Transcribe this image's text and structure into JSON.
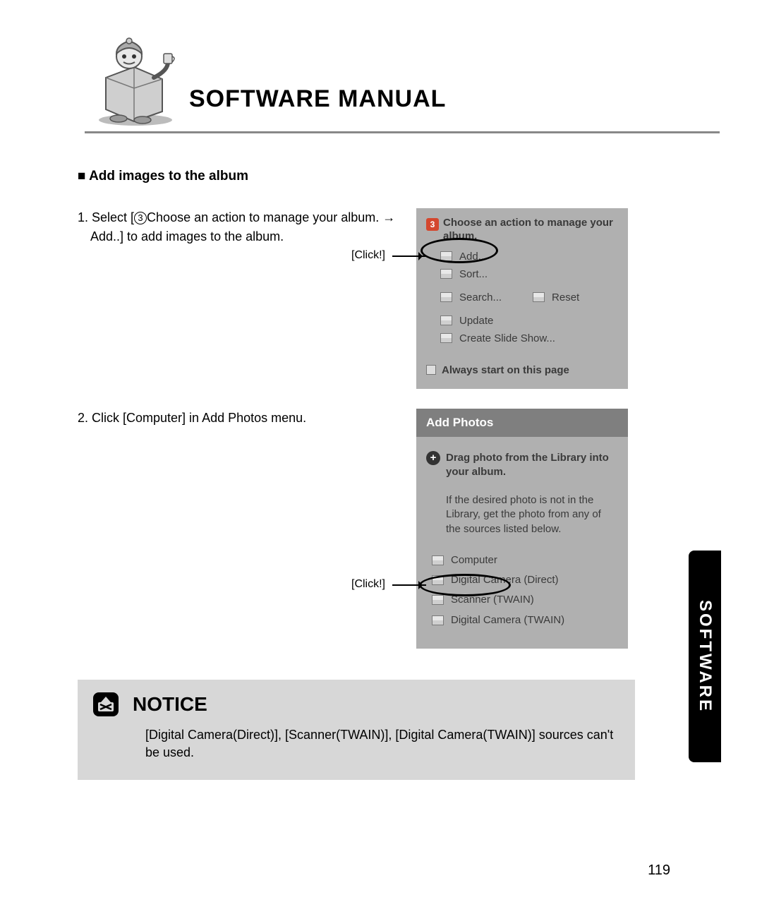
{
  "header": {
    "title": "SOFTWARE MANUAL"
  },
  "subheading": "Add images to the album",
  "step1": {
    "prefix": "1. Select [",
    "circled": "3",
    "middle": "Choose an action to manage your album. →",
    "second_line": "Add..] to add images to the album.",
    "click": "[Click!]"
  },
  "panel1": {
    "badge": "3",
    "heading": "Choose an action to manage your album.",
    "items": {
      "add": "Add...",
      "sort": "Sort...",
      "search": "Search...",
      "reset": "Reset",
      "update": "Update",
      "slideshow": "Create Slide Show..."
    },
    "always": "Always start on this page"
  },
  "step2": {
    "text": "2. Click [Computer] in Add Photos menu.",
    "click": "[Click!]"
  },
  "panel2": {
    "title": "Add Photos",
    "drag": "Drag photo from the Library into your album.",
    "desc": "If the desired photo is not in the Library, get the photo from any of the sources listed below.",
    "items": {
      "computer": "Computer",
      "direct": "Digital Camera (Direct)",
      "scanner": "Scanner (TWAIN)",
      "twain": "Digital Camera (TWAIN)"
    }
  },
  "notice": {
    "title": "NOTICE",
    "text": "[Digital Camera(Direct)], [Scanner(TWAIN)], [Digital Camera(TWAIN)] sources can't be used."
  },
  "side_tab": "SOFTWARE",
  "page_number": "119"
}
